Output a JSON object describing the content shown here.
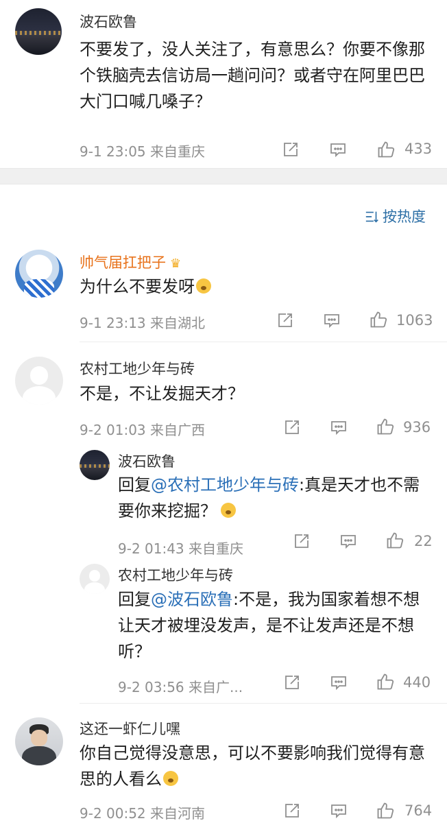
{
  "top_comment": {
    "author": "波石欧鲁",
    "text": "不要发了，没人关注了，有意思么？你要不像那个铁脑壳去信访局一趟问问？或者守在阿里巴巴大门口喊几嗓子？",
    "meta": "9-1 23:05  来自重庆",
    "likes": "433"
  },
  "sort_label": "按热度",
  "comments": [
    {
      "author": "帅气届扛把子",
      "text": "为什么不要发呀",
      "meta": "9-1 23:13  来自湖北",
      "likes": "1063"
    },
    {
      "author": "农村工地少年与砖",
      "text": "不是，不让发掘天才？",
      "meta": "9-2 01:03  来自广西",
      "likes": "936",
      "replies": [
        {
          "author": "波石欧鲁",
          "reply_prefix": "回复",
          "mention": "@农村工地少年与砖",
          "text": ":真是天才也不需要你来挖掘？",
          "meta": "9-2 01:43  来自重庆",
          "likes": "22"
        },
        {
          "author": "农村工地少年与砖",
          "reply_prefix": "回复",
          "mention": "@波石欧鲁",
          "text": ":不是，我为国家着想不想让天才被埋没发声，是不让发声还是不想听？",
          "meta": "9-2 03:56  来自广...",
          "likes": "440"
        }
      ]
    },
    {
      "author": "这还一虾仁儿嘿",
      "text": "你自己觉得没意思，可以不要影响我们觉得有意思的人看么",
      "meta": "9-2 00:52  来自河南",
      "likes": "764"
    }
  ],
  "icons": [
    "share-icon",
    "comment-icon",
    "like-icon",
    "sort-icon",
    "crown-icon"
  ],
  "colors": {
    "mention": "#2a6fb7",
    "vip_name": "#e8731c",
    "meta": "#8f8f8f",
    "sort": "#2d6fa6"
  }
}
